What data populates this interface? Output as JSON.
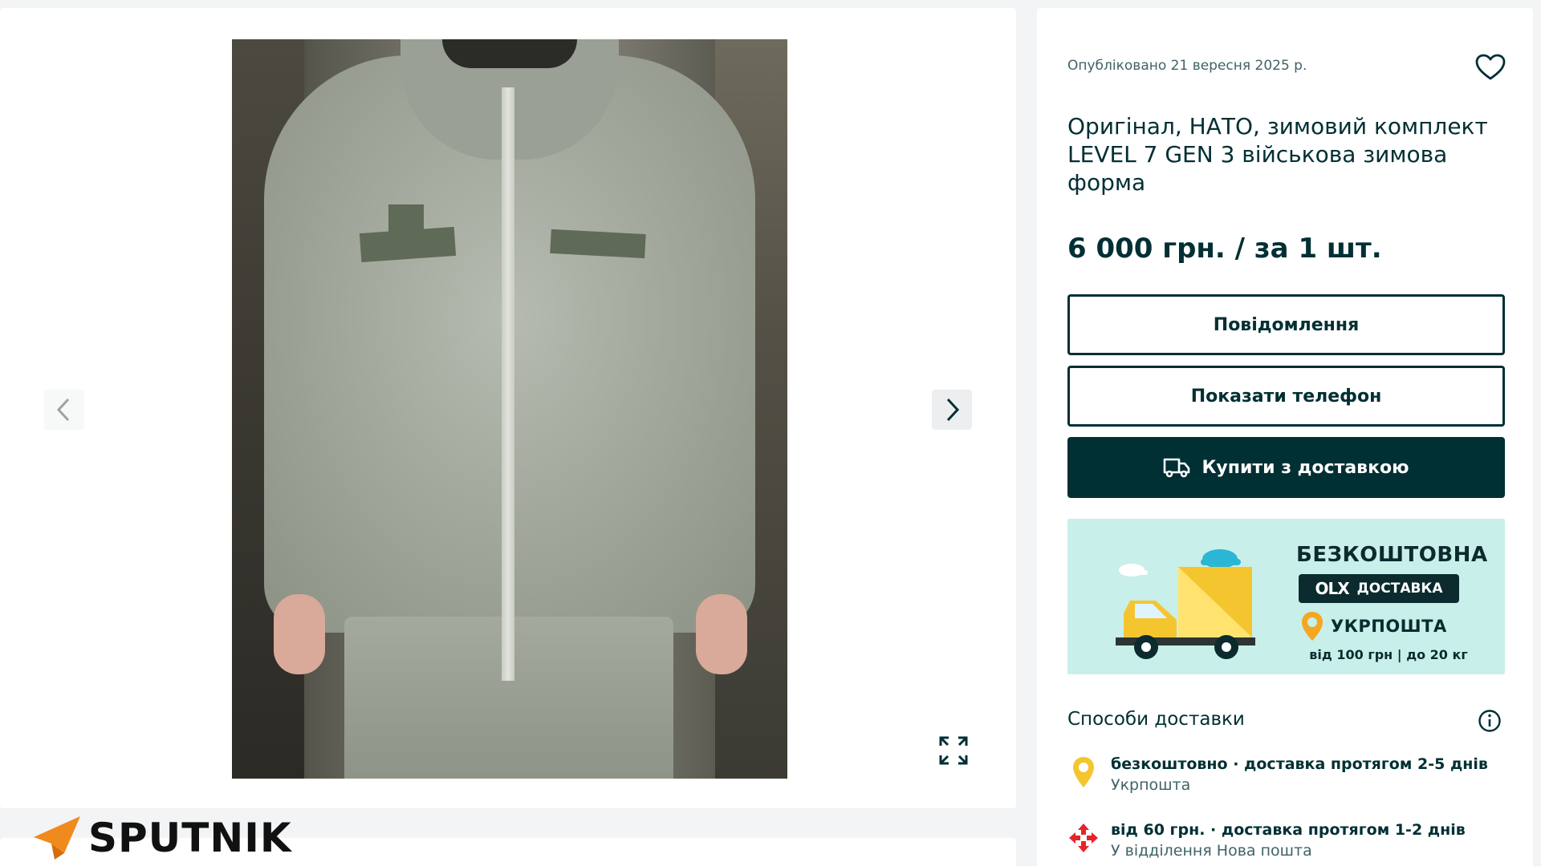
{
  "gallery": {
    "prev_icon": "chevron-left-icon",
    "next_icon": "chevron-right-icon",
    "expand_icon": "expand-icon"
  },
  "watermark": {
    "brand": "SPUTNIK"
  },
  "listing": {
    "published": "Опубліковано 21 вересня 2025 р.",
    "title": "Оригінал, НАТО, зимовий комплект LEVEL 7 GEN 3 військова зимова форма",
    "price": "6 000 грн. / за 1 шт.",
    "favorite_icon": "heart-icon"
  },
  "actions": {
    "message_label": "Повідомлення",
    "phone_label": "Показати телефон",
    "buy_label": "Купити з доставкою"
  },
  "promo": {
    "title": "БЕЗКОШТОВНА",
    "olx_logo": "OLX",
    "olx_label": "ДОСТАВКА",
    "carrier": "УКРПОШТА",
    "terms": "від 100 грн | до 20 кг"
  },
  "delivery": {
    "heading": "Способи доставки",
    "options": [
      {
        "main": "безкоштовно · доставка протягом 2-5 днів",
        "sub": "Укрпошта",
        "icon": "ukrposhta-pin-icon"
      },
      {
        "main": "від 60 грн. · доставка протягом 1-2 днів",
        "sub": "У відділення Нова пошта",
        "icon": "nova-poshta-icon"
      }
    ]
  },
  "colors": {
    "primary": "#002f34",
    "page_bg": "#f2f4f5",
    "promo_bg": "#c9efea",
    "promo_yellow": "#f5c530"
  }
}
